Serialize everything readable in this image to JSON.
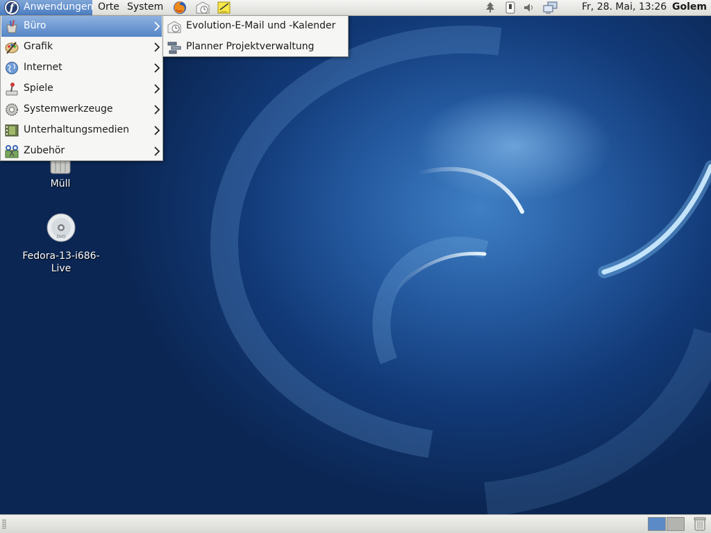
{
  "top_panel": {
    "menus": [
      {
        "label": "Anwendungen",
        "active": true
      },
      {
        "label": "Orte"
      },
      {
        "label": "System"
      }
    ],
    "launchers": [
      "firefox-icon",
      "evolution-icon",
      "notes-icon"
    ],
    "tray_icons": [
      "update-tree-icon",
      "usb-device-icon",
      "volume-icon",
      "network-icon"
    ],
    "clock": "Fr, 28. Mai, 13:26",
    "username": "Golem"
  },
  "applications_menu": {
    "items": [
      {
        "label": "Büro",
        "icon": "office-icon",
        "highlighted": true
      },
      {
        "label": "Grafik",
        "icon": "graphics-icon"
      },
      {
        "label": "Internet",
        "icon": "internet-icon"
      },
      {
        "label": "Spiele",
        "icon": "games-icon"
      },
      {
        "label": "Systemwerkzeuge",
        "icon": "system-tools-icon"
      },
      {
        "label": "Unterhaltungsmedien",
        "icon": "multimedia-icon"
      },
      {
        "label": "Zubehör",
        "icon": "accessories-icon"
      }
    ]
  },
  "office_submenu": {
    "items": [
      {
        "label": "Evolution-E-Mail und -Kalender",
        "icon": "evolution-icon"
      },
      {
        "label": "Planner Projektverwaltung",
        "icon": "planner-icon"
      }
    ]
  },
  "desktop": {
    "icons": [
      {
        "label": "Müll",
        "icon": "trash-icon"
      },
      {
        "label": "Fedora-13-i686-Live",
        "icon": "dvd-icon"
      }
    ]
  },
  "bottom_panel": {
    "workspaces": 2,
    "active_workspace": 1
  },
  "colors": {
    "menu_highlight": "#5585c6",
    "wallpaper_base": "#123a78"
  }
}
